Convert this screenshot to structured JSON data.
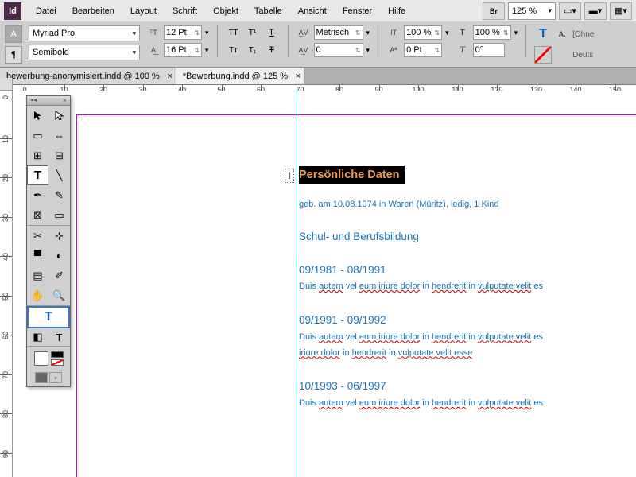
{
  "menubar": {
    "items": [
      "Datei",
      "Bearbeiten",
      "Layout",
      "Schrift",
      "Objekt",
      "Tabelle",
      "Ansicht",
      "Fenster",
      "Hilfe"
    ],
    "zoom": "125 %"
  },
  "control": {
    "font": "Myriad Pro",
    "font_weight": "Semibold",
    "font_size": "12 Pt",
    "leading": "16 Pt",
    "kerning_mode": "Metrisch",
    "tracking": "0",
    "scale_v": "100 %",
    "scale_h": "100 %",
    "baseline": "0 Pt",
    "rotation": "0°",
    "lang_hint": "Deuts",
    "fill_hint": "[Ohne"
  },
  "tabs": [
    {
      "label": "bewerbung-anonymisiert.indd @ 100 %",
      "active": false
    },
    {
      "label": "*Bewerbung.indd @ 125 %",
      "active": true
    }
  ],
  "ruler_h": [
    0,
    10,
    20,
    30,
    40,
    50,
    60,
    70,
    80,
    90,
    100,
    110,
    120,
    130,
    140,
    150
  ],
  "ruler_v": [
    0,
    10,
    20,
    30,
    40,
    50,
    60,
    70,
    80,
    90
  ],
  "doc": {
    "heading": "Persönliche Daten",
    "line1": "geb. am 10.08.1974 in Waren (Müritz), ledig, 1 Kind ",
    "section2": "Schul- und Berufsbildung",
    "dates3": "09/1981 - 08/1991",
    "lorem1_pre": "Duis ",
    "lorem1_u1": "autem",
    "lorem1_m1": " vel ",
    "lorem1_u2": "eum iriure dolor",
    "lorem1_m2": " in ",
    "lorem1_u3": "hendrerit",
    "lorem1_m3": " in ",
    "lorem1_u4": "vulputate velit",
    "lorem1_end": " es",
    "dates4": "09/1991 - 09/1992",
    "lorem2_pre": "Duis ",
    "lorem2_u1": "autem",
    "lorem2_m1": " vel ",
    "lorem2_u2": "eum iriure dolor",
    "lorem2_m2": " in ",
    "lorem2_u3": "hendrerit",
    "lorem2_m3": " in ",
    "lorem2_u4": "vulputate velit",
    "lorem2_end": " es",
    "lorem2b_u1": "iriure dolor",
    "lorem2b_m1": " in ",
    "lorem2b_u2": "hendrerit",
    "lorem2b_m2": " in ",
    "lorem2b_u3": "vulputate velit esse",
    "dates5": "10/1993 - 06/1997",
    "lorem3_pre": "Duis ",
    "lorem3_u1": "autem",
    "lorem3_m1": " vel ",
    "lorem3_u2": "eum iriure dolor",
    "lorem3_m2": " in ",
    "lorem3_u3": "hendrerit",
    "lorem3_m3": " in ",
    "lorem3_u4": "vulputate velit",
    "lorem3_end": " es"
  }
}
